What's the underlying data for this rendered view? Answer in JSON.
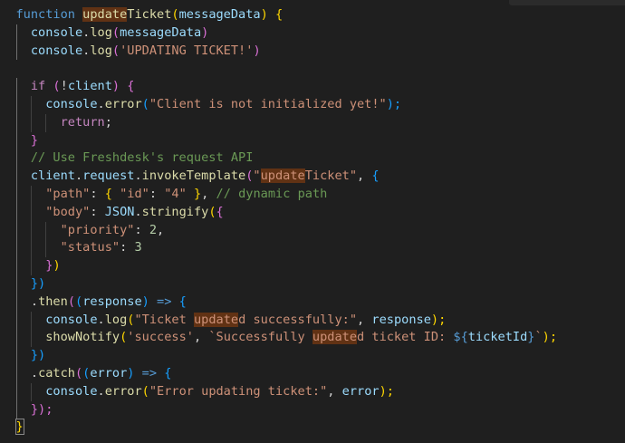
{
  "editor": {
    "language": "javascript",
    "theme": "dark",
    "colors": {
      "background": "#1f1f1f",
      "keyword": "#569cd6",
      "control": "#c586c0",
      "function": "#dcdcaa",
      "variable": "#9cdcfe",
      "string": "#ce9178",
      "number": "#b5cea8",
      "comment": "#6a9955",
      "highlight": "#613214"
    },
    "lines": [
      [
        "function",
        " ",
        "update",
        "Ticket",
        "(",
        "messageData",
        ") ",
        "{"
      ],
      [
        "console",
        ".",
        "log",
        "(",
        "messageData",
        ")"
      ],
      [
        "console",
        ".",
        "log",
        "(",
        "'UPDATING TICKET!'",
        ")"
      ],
      [],
      [
        "if",
        " (",
        "!",
        "client",
        ") ",
        "{"
      ],
      [
        "console",
        ".",
        "error",
        "(",
        "\"Client is not initialized yet!\"",
        ");"
      ],
      [
        "return",
        ";"
      ],
      [
        "}"
      ],
      [
        "// Use Freshdesk's request API"
      ],
      [
        "client",
        ".",
        "request",
        ".",
        "invokeTemplate",
        "(",
        "\"",
        "update",
        "Ticket\"",
        ", ",
        "{"
      ],
      [
        "\"path\"",
        ": ",
        "{",
        " ",
        "\"id\"",
        ": ",
        "\"4\"",
        " ",
        "}",
        ", ",
        "// dynamic path"
      ],
      [
        "\"body\"",
        ": ",
        "JSON",
        ".",
        "stringify",
        "(",
        "{"
      ],
      [
        "\"priority\"",
        ": ",
        "2",
        ","
      ],
      [
        "\"status\"",
        ": ",
        "3"
      ],
      [
        "}",
        ")"
      ],
      [
        "})"
      ],
      [
        ".",
        "then",
        "(",
        "(",
        "response",
        ") ",
        "=>",
        " ",
        "{"
      ],
      [
        "console",
        ".",
        "log",
        "(",
        "\"Ticket ",
        "update",
        "d successfully:\"",
        ", ",
        "response",
        ");"
      ],
      [
        "showNotify",
        "(",
        "'success'",
        ", ",
        "`Successfully ",
        "update",
        "d ticket ID: ",
        "${",
        "ticketId",
        "}",
        "`",
        ");"
      ],
      [
        "})"
      ],
      [
        ".",
        "catch",
        "(",
        "(",
        "error",
        ") ",
        "=>",
        " ",
        "{"
      ],
      [
        "console",
        ".",
        "error",
        "(",
        "\"Error updating ticket:\"",
        ", ",
        "error",
        ");"
      ],
      [
        "});"
      ],
      [
        "}"
      ]
    ]
  }
}
